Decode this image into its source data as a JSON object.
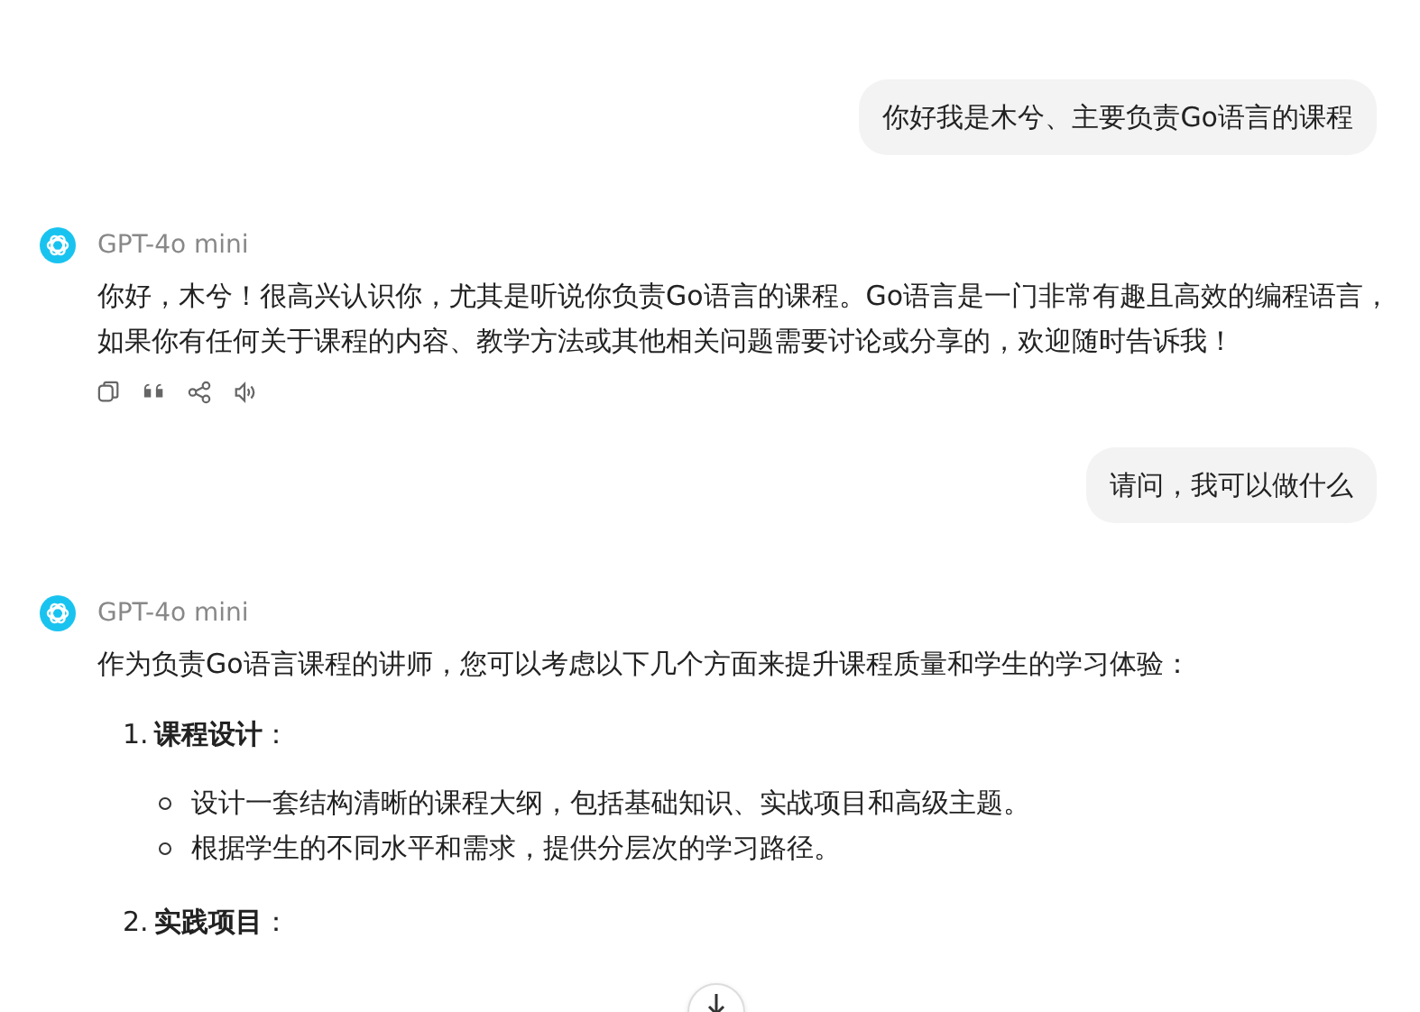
{
  "messages": [
    {
      "kind": "user",
      "text": "你好我是木兮、主要负责Go语言的课程"
    },
    {
      "kind": "assistant",
      "model": "GPT-4o mini",
      "paragraphs": [
        "你好，木兮！很高兴认识你，尤其是听说你负责Go语言的课程。Go语言是一门非常有趣且高效的编程语言，如果你有任何关于课程的内容、教学方法或其他相关问题需要讨论或分享的，欢迎随时告诉我！"
      ],
      "actions": true
    },
    {
      "kind": "user",
      "text": "请问，我可以做什么"
    },
    {
      "kind": "assistant",
      "model": "GPT-4o mini",
      "paragraphs": [
        "作为负责Go语言课程的讲师，您可以考虑以下几个方面来提升课程质量和学生的学习体验："
      ],
      "list": [
        {
          "number": "1.",
          "title": "课程设计",
          "colon": "：",
          "bullets": [
            "设计一套结构清晰的课程大纲，包括基础知识、实战项目和高级主题。",
            "根据学生的不同水平和需求，提供分层次的学习路径。"
          ]
        },
        {
          "number": "2.",
          "title": "实践项目",
          "colon": "："
        }
      ],
      "actions": false
    }
  ]
}
